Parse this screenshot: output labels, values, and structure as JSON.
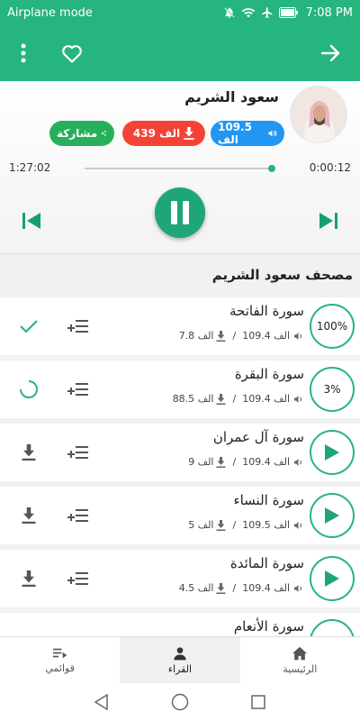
{
  "status_bar": {
    "mode": "Airplane mode",
    "time": "7:08 PM"
  },
  "app_bar": {
    "menu_icon": "more-vert-icon",
    "favorite_icon": "heart-outline-icon",
    "back_icon": "arrow-forward-icon"
  },
  "player": {
    "reciter_name": "سعود الشريم",
    "listens_count": "109.5 الف",
    "downloads_count": "439 الف",
    "share_label": "مشاركة",
    "duration": "1:27:02",
    "position": "0:00:12",
    "progress_fraction": 0.02,
    "state": "playing"
  },
  "mushaf_title": "مصحف سعود الشريم",
  "surahs": [
    {
      "name": "سورة الفاتحة",
      "listens": "109.4 الف",
      "downloads": "7.8 الف",
      "badge": "100%",
      "status": "downloaded"
    },
    {
      "name": "سورة البقرة",
      "listens": "109.4 الف",
      "downloads": "88.5 الف",
      "badge": "3%",
      "status": "downloading"
    },
    {
      "name": "سورة آل عمران",
      "listens": "109.4 الف",
      "downloads": "9 الف",
      "badge": "",
      "status": "not-downloaded"
    },
    {
      "name": "سورة النساء",
      "listens": "109.5 الف",
      "downloads": "5 الف",
      "badge": "",
      "status": "not-downloaded"
    },
    {
      "name": "سورة المائدة",
      "listens": "109.4 الف",
      "downloads": "4.5 الف",
      "badge": "",
      "status": "not-downloaded"
    },
    {
      "name": "سورة الأنعام",
      "listens": "",
      "downloads": "",
      "badge": "",
      "status": "not-downloaded"
    }
  ],
  "meta_separator": "/",
  "bottom_nav": [
    {
      "label": "قوائمي",
      "icon": "playlist-icon",
      "active": false
    },
    {
      "label": "القراء",
      "icon": "person-icon",
      "active": true
    },
    {
      "label": "الرئيسية",
      "icon": "home-icon",
      "active": false
    }
  ],
  "colors": {
    "primary": "#26b47f",
    "play_button": "#1fa676",
    "listens_pill": "#2196f3",
    "downloads_pill": "#f44336",
    "share_pill": "#27b05c"
  }
}
